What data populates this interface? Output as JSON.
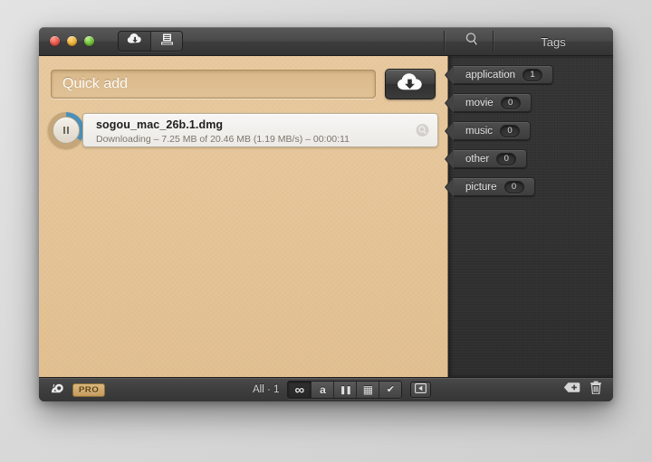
{
  "window": {
    "traffic_lights": [
      {
        "name": "close",
        "color": "#ef5f52"
      },
      {
        "name": "minimize",
        "color": "#f0b73f"
      },
      {
        "name": "zoom",
        "color": "#78c742"
      }
    ],
    "toolbar_segments": [
      {
        "icon": "cloud-download-icon",
        "active": true
      },
      {
        "icon": "inbox-tray-icon",
        "active": false
      }
    ],
    "search_icon": "search-icon"
  },
  "tags_panel": {
    "title": "Tags",
    "tags": [
      {
        "label": "application",
        "count": "1"
      },
      {
        "label": "movie",
        "count": "0"
      },
      {
        "label": "music",
        "count": "0"
      },
      {
        "label": "other",
        "count": "0"
      },
      {
        "label": "picture",
        "count": "0"
      }
    ],
    "footer": {
      "add_tag_icon": "tag-plus-icon",
      "delete_tag_icon": "trash-icon"
    }
  },
  "main": {
    "quick_add": {
      "placeholder": "Quick add",
      "value": "",
      "button_icon": "cloud-download-icon"
    },
    "downloads": [
      {
        "name": "sogou_mac_26b.1.dmg",
        "status": "Downloading – 7.25 MB of 20.46 MB (1.19 MB/s) – 00:00:11",
        "progress_percent": 35,
        "state_icon": "pause-icon",
        "reveal_icon": "magnifier-icon"
      }
    ]
  },
  "bottom_bar": {
    "speed_limit_icon": "snail-icon",
    "pro_badge": "PRO",
    "count_label": "All · 1",
    "filters": [
      {
        "icon": "infinity-icon",
        "glyph": "∞",
        "active": true
      },
      {
        "icon": "letter-a-icon",
        "glyph": "a",
        "active": false
      },
      {
        "icon": "pause-icon",
        "glyph": "❚❚",
        "active": false
      },
      {
        "icon": "calendar-icon",
        "glyph": "▦",
        "active": false
      },
      {
        "icon": "check-icon",
        "glyph": "✔",
        "active": false
      }
    ],
    "sidebar_toggle_icon": "sidebar-toggle-icon"
  },
  "colors": {
    "content_tan": "#e3c296",
    "panel_dark": "#323232",
    "chrome": "#3e3e3e",
    "pro_gold": "#c49a5e",
    "progress_blue": "#4a90b8"
  }
}
